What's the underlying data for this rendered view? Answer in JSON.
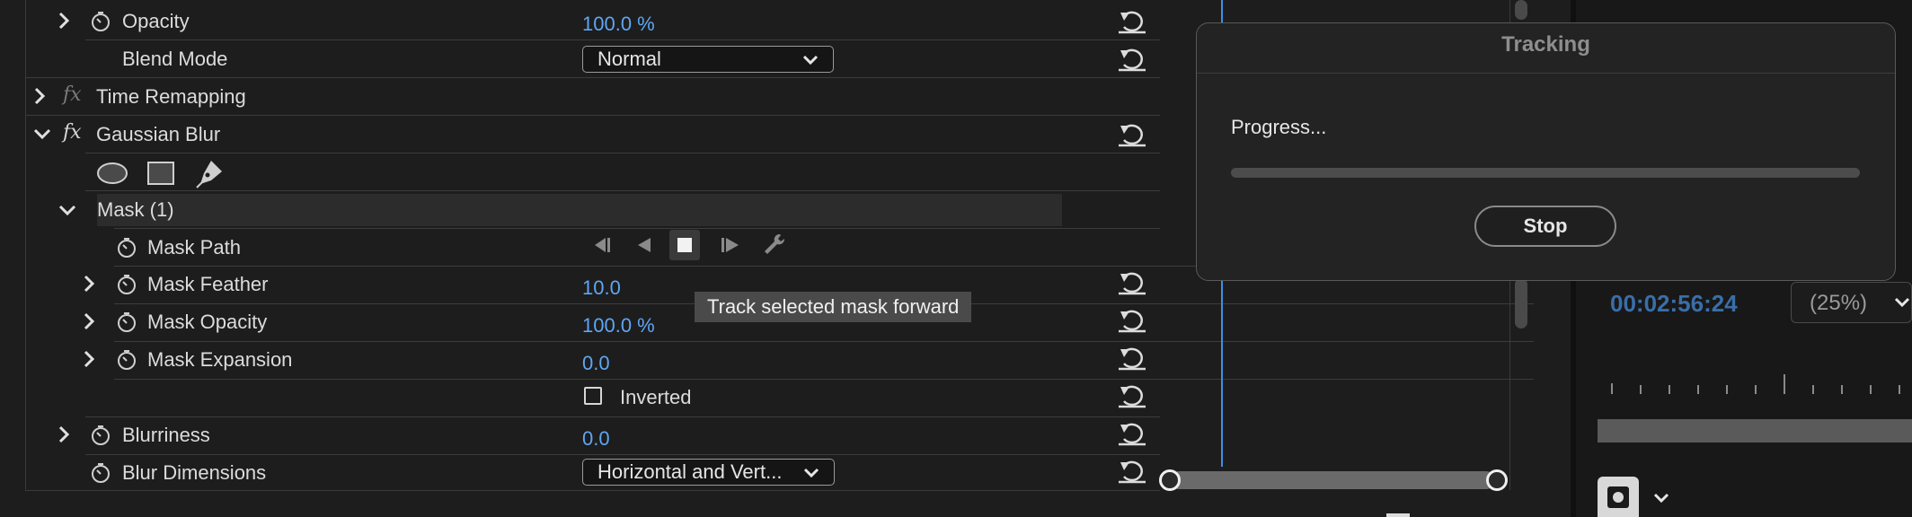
{
  "effect_controls": {
    "rows": {
      "opacity": {
        "label": "Opacity",
        "value": "100.0 %"
      },
      "blend_mode": {
        "label": "Blend Mode",
        "value": "Normal"
      },
      "time_remapping": {
        "label": "Time Remapping",
        "fx": "fx"
      },
      "gaussian_blur": {
        "label": "Gaussian Blur",
        "fx": "fx"
      },
      "mask": {
        "label": "Mask (1)"
      },
      "mask_path": {
        "label": "Mask Path"
      },
      "mask_feather": {
        "label": "Mask Feather",
        "value": "10.0"
      },
      "mask_opacity": {
        "label": "Mask Opacity",
        "value": "100.0 %"
      },
      "mask_expansion": {
        "label": "Mask Expansion",
        "value": "0.0"
      },
      "inverted": {
        "label": "Inverted",
        "checked": false
      },
      "blurriness": {
        "label": "Blurriness",
        "value": "0.0"
      },
      "blur_dimensions": {
        "label": "Blur Dimensions",
        "value": "Horizontal and Vert..."
      }
    },
    "mask_tools": [
      "ellipse-mask-icon",
      "rectangle-mask-icon",
      "pen-mask-icon"
    ],
    "mask_path_controls": [
      "track-backward-icon",
      "track-one-frame-backward-icon",
      "stop-tracking-icon",
      "track-one-frame-forward-icon",
      "tracking-method-wrench-icon"
    ]
  },
  "tooltip": {
    "text": "Track selected mask forward"
  },
  "dialog": {
    "title": "Tracking",
    "progress_label": "Progress...",
    "progress_percent": 0,
    "stop_label": "Stop"
  },
  "monitor": {
    "timecode": "00:02:56:24",
    "zoom": "(25%)"
  },
  "colors": {
    "accent_blue": "#5fa6f3",
    "timecode_blue": "#3a6ea8",
    "playhead": "#3f8ee8"
  }
}
